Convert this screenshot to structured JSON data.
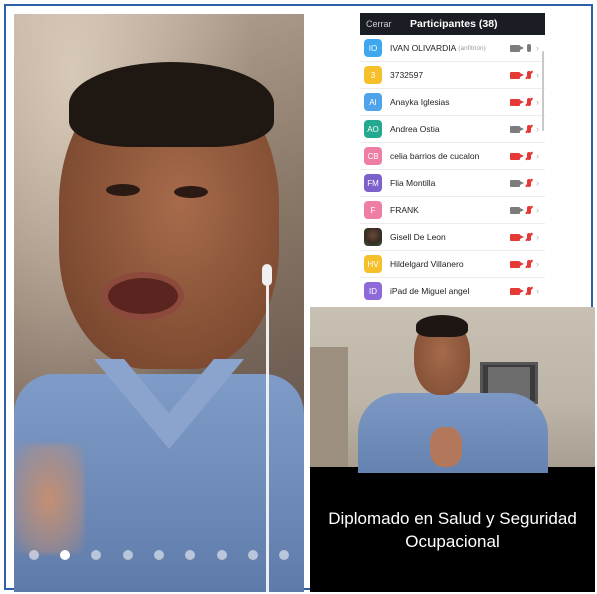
{
  "participants_panel": {
    "close_label": "Cerrar",
    "title": "Participantes (38)",
    "items": [
      {
        "initials": "IO",
        "name": "IVAN OLIVARDIA",
        "tag": "(anfitrión)",
        "color": "#3fa6f0",
        "video": "on",
        "mic": "on"
      },
      {
        "initials": "3",
        "name": "3732597",
        "tag": "",
        "color": "#f6c02b",
        "video": "off",
        "mic": "off"
      },
      {
        "initials": "AI",
        "name": "Anayka Iglesias",
        "tag": "",
        "color": "#4ea3ea",
        "video": "off",
        "mic": "off"
      },
      {
        "initials": "AO",
        "name": "Andrea Ostia",
        "tag": "",
        "color": "#23a98f",
        "video": "on",
        "mic": "off"
      },
      {
        "initials": "CB",
        "name": "celia barrios de cucalon",
        "tag": "",
        "color": "#ef7ea4",
        "video": "off",
        "mic": "off"
      },
      {
        "initials": "FM",
        "name": "Flia Montilla",
        "tag": "",
        "color": "#7b61c9",
        "video": "on",
        "mic": "off"
      },
      {
        "initials": "F",
        "name": "FRANK",
        "tag": "",
        "color": "#ef7ea4",
        "video": "on",
        "mic": "off"
      },
      {
        "initials": "",
        "name": "Gisell De Leon",
        "tag": "",
        "color": "photo",
        "video": "off",
        "mic": "off"
      },
      {
        "initials": "HV",
        "name": "Hildelgard Villanero",
        "tag": "",
        "color": "#f6c02b",
        "video": "off",
        "mic": "off"
      },
      {
        "initials": "ID",
        "name": "iPad de Miguel angel",
        "tag": "",
        "color": "#8e6ad9",
        "video": "off",
        "mic": "off"
      }
    ]
  },
  "gallery": {
    "page_count": 9,
    "active_page": 2
  },
  "presentation": {
    "caption_line1": "Diplomado en Salud y Seguridad",
    "caption_line2": "Ocupacional"
  },
  "colors": {
    "muted": "#e53935",
    "active_icon": "#7c7c7c",
    "header_bg": "#1a1d24",
    "frame_border": "#2d5fa8"
  }
}
